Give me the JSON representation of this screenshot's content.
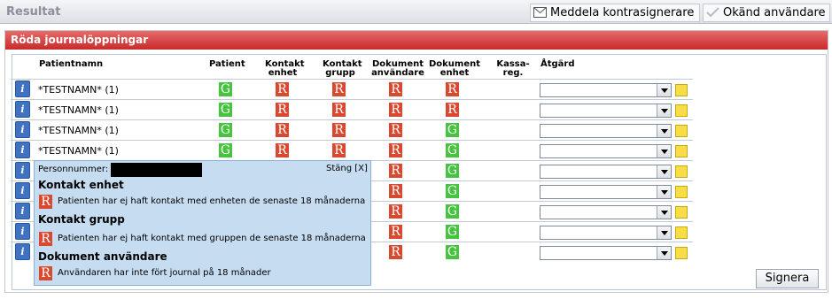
{
  "topbar": {
    "title": "Resultat",
    "meddela_label": "Meddela kontrasignerare",
    "okand_label": "Okänd användare"
  },
  "panel": {
    "title": "Röda journalöppningar",
    "columns": [
      "Patientnamn",
      "Patient",
      "Kontakt enhet",
      "Kontakt grupp",
      "Dokument användare",
      "Dokument enhet",
      "Kassa-reg.",
      "Åtgärd"
    ],
    "rows": [
      {
        "name": "*TESTNAMN* (1)",
        "patient": "G",
        "kontakt_enhet": "R",
        "kontakt_grupp": "R",
        "dok_anv": "R",
        "dok_enhet": "R"
      },
      {
        "name": "*TESTNAMN* (1)",
        "patient": "G",
        "kontakt_enhet": "R",
        "kontakt_grupp": "R",
        "dok_anv": "R",
        "dok_enhet": "R"
      },
      {
        "name": "*TESTNAMN* (1)",
        "patient": "G",
        "kontakt_enhet": "R",
        "kontakt_grupp": "R",
        "dok_anv": "R",
        "dok_enhet": "G"
      },
      {
        "name": "*TESTNAMN* (1)",
        "patient": "G",
        "kontakt_enhet": "R",
        "kontakt_grupp": "R",
        "dok_anv": "R",
        "dok_enhet": "G"
      },
      {
        "dok_anv": "R",
        "dok_enhet": "G"
      },
      {
        "dok_anv": "R",
        "dok_enhet": "G"
      },
      {
        "dok_anv": "R",
        "dok_enhet": "G"
      },
      {
        "dok_anv": "R",
        "dok_enhet": "G"
      },
      {
        "dok_anv": "R",
        "dok_enhet": "G"
      }
    ]
  },
  "popup": {
    "personnummer_label": "Personnummer:",
    "close_label": "Stäng [X]",
    "sections": [
      {
        "title": "Kontakt enhet",
        "badge": "R",
        "text": "Patienten har ej haft kontakt med enheten de senaste 18 månaderna"
      },
      {
        "title": "Kontakt grupp",
        "badge": "R",
        "text": "Patienten har ej haft kontakt med gruppen de senaste 18 månaderna"
      },
      {
        "title": "Dokument användare",
        "badge": "R",
        "text": "Användaren har inte fört journal på 18 månader"
      }
    ]
  },
  "signera_label": "Signera",
  "colors": {
    "green": "#46c440",
    "red": "#d8492f",
    "header_red": "#c92a2a",
    "popup_bg": "#c6dcf1"
  }
}
